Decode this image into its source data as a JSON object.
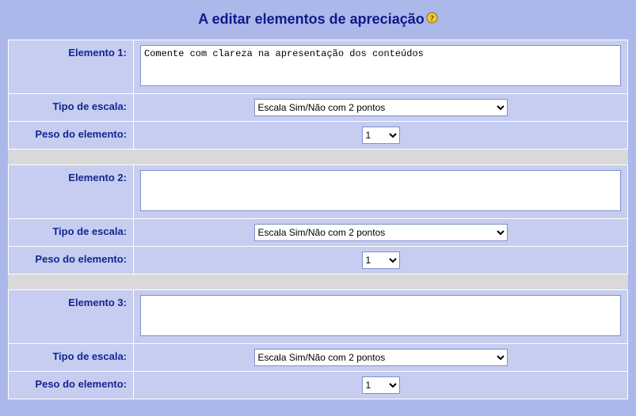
{
  "title": "A editar elementos de apreciação",
  "labels": {
    "element": "Elemento",
    "scale_type": "Tipo de escala:",
    "element_weight": "Peso do elemento:"
  },
  "scale_options": [
    "Escala Sim/Não com 2 pontos"
  ],
  "weight_options": [
    "1"
  ],
  "elements": [
    {
      "index": 1,
      "text": "Comente com clareza na apresentação dos conteúdos",
      "scale": "Escala Sim/Não com 2 pontos",
      "weight": "1"
    },
    {
      "index": 2,
      "text": "",
      "scale": "Escala Sim/Não com 2 pontos",
      "weight": "1"
    },
    {
      "index": 3,
      "text": "",
      "scale": "Escala Sim/Não com 2 pontos",
      "weight": "1"
    }
  ]
}
